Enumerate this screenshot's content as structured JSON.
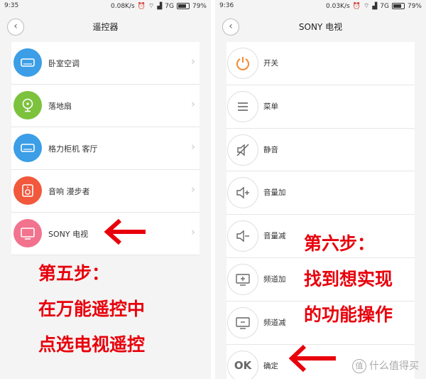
{
  "left": {
    "status": {
      "time": "9:35",
      "speed": "0.08K/s",
      "network": "7G",
      "battery": "79%"
    },
    "title": "遥控器",
    "items": [
      {
        "label": "卧室空调",
        "icon": "air-conditioner-icon",
        "color": "#3b9ee6"
      },
      {
        "label": "落地扇",
        "icon": "fan-icon",
        "color": "#7cc23d"
      },
      {
        "label": "格力柜机 客厅",
        "icon": "air-conditioner-icon",
        "color": "#3b9ee6"
      },
      {
        "label": "音响 漫步者",
        "icon": "speaker-icon",
        "color": "#f1583c"
      },
      {
        "label": "SONY 电视",
        "icon": "tv-icon",
        "color": "#f2738e"
      }
    ],
    "annotation": {
      "line1": "第五步：",
      "line2": "在万能遥控中",
      "line3": "点选电视遥控"
    }
  },
  "right": {
    "status": {
      "time": "9:36",
      "speed": "0.03K/s",
      "network": "7G",
      "battery": "79%"
    },
    "title": "SONY 电视",
    "items": [
      {
        "label": "开关",
        "icon": "power-icon"
      },
      {
        "label": "菜单",
        "icon": "menu-icon"
      },
      {
        "label": "静音",
        "icon": "mute-icon"
      },
      {
        "label": "音量加",
        "icon": "volume-up-icon"
      },
      {
        "label": "音量减",
        "icon": "volume-down-icon"
      },
      {
        "label": "频道加",
        "icon": "channel-up-icon"
      },
      {
        "label": "频道减",
        "icon": "channel-down-icon"
      },
      {
        "label": "确定",
        "icon": "ok-icon",
        "glyph": "OK"
      }
    ],
    "annotation": {
      "line1": "第六步：",
      "line2": "找到想实现",
      "line3": "的功能操作"
    }
  },
  "watermark": {
    "badge": "值",
    "text": "什么值得买"
  },
  "colors": {
    "accent_red": "#e8000b",
    "power_orange": "#f28b30"
  }
}
